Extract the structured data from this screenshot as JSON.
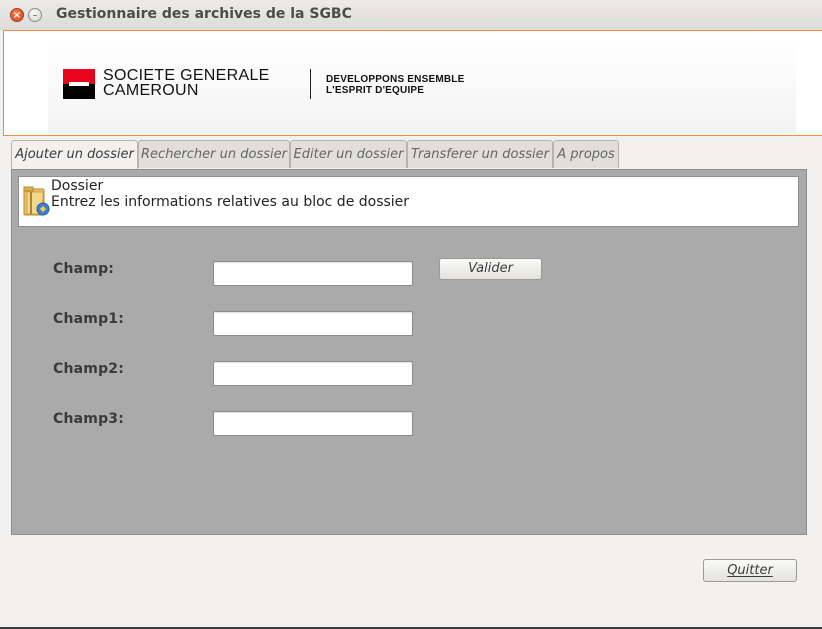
{
  "window": {
    "title": "Gestionnaire des archives de la SGBC",
    "close_glyph": "×",
    "minimize_glyph": "–"
  },
  "banner": {
    "brand_line1": "SOCIETE GENERALE",
    "brand_line2": "CAMEROUN",
    "tagline_line1": "DEVELOPPONS ENSEMBLE",
    "tagline_line2": "L'ESPRIT D'EQUIPE",
    "logo_colors": {
      "top": "#e9041e",
      "bottom": "#000000"
    }
  },
  "tabs": [
    {
      "label": "Ajouter un dossier",
      "active": true
    },
    {
      "label": "Rechercher un dossier",
      "active": false
    },
    {
      "label": "Editer un dossier",
      "active": false
    },
    {
      "label": "Transferer un dossier",
      "active": false
    },
    {
      "label": "A propos",
      "active": false
    }
  ],
  "info": {
    "icon": "folder-icon",
    "title": "Dossier",
    "description": "Entrez les informations relatives au bloc de dossier"
  },
  "form": {
    "fields": [
      {
        "label": "Champ:",
        "value": ""
      },
      {
        "label": "Champ1:",
        "value": ""
      },
      {
        "label": "Champ2:",
        "value": ""
      },
      {
        "label": "Champ3:",
        "value": ""
      }
    ],
    "validate_label": "Valider"
  },
  "footer": {
    "quit_label": "Quitter"
  },
  "colors": {
    "panel_bg": "#aaaaaa",
    "banner_border": "#f08a4b",
    "window_bg": "#f2f1f0"
  }
}
